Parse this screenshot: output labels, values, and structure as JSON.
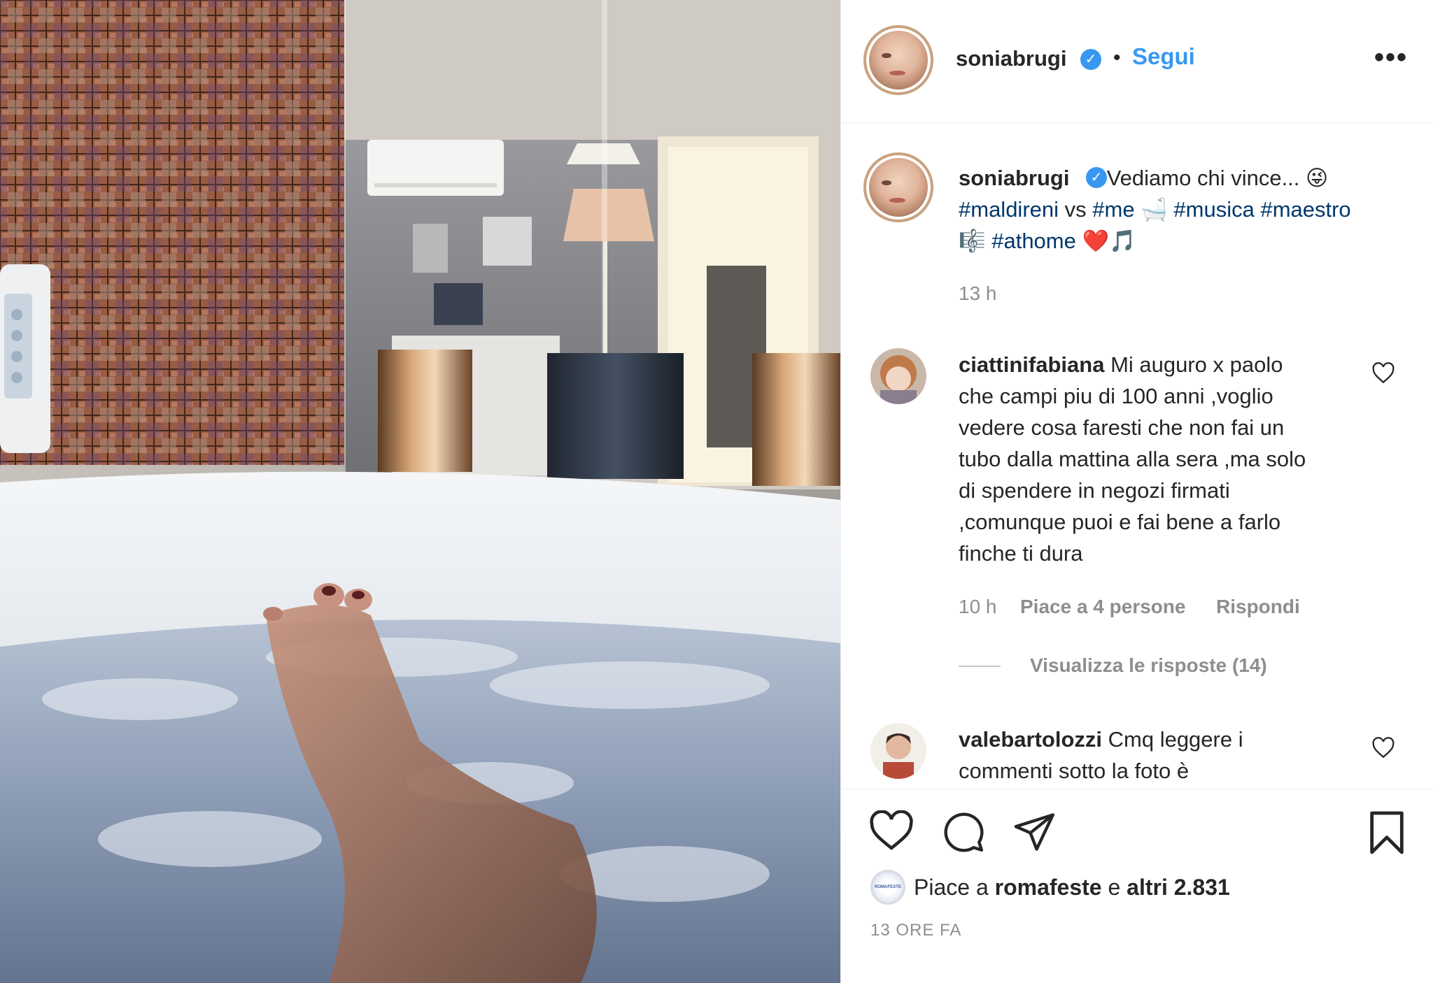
{
  "post": {
    "author": "soniabrugi",
    "follow_label": "Segui",
    "separator": "•",
    "more_label": "•••",
    "verified_mark": "✓"
  },
  "caption": {
    "username": "soniabrugi",
    "line1": "Vediamo chi vince... 😜",
    "line2_parts": [
      "#maldireni",
      " vs ",
      "#me",
      " 🛁 ",
      "#musica",
      " ",
      "#maestro"
    ],
    "line3_parts": [
      "🎼 ",
      "#athome",
      " ❤️🎵"
    ],
    "time": "13 h"
  },
  "comments": [
    {
      "username": "ciattinifabiana",
      "lines": [
        "Mi auguro x paolo",
        "che campi piu di 100 anni ,voglio",
        "vedere cosa faresti che non fai un",
        "tubo dalla mattina alla sera ,ma solo",
        "di spendere in negozi firmati",
        ",comunque puoi e fai bene a farlo",
        "finche ti dura"
      ],
      "time": "10 h",
      "likes": "Piace a 4 persone",
      "reply": "Rispondi",
      "view_replies": "Visualizza le risposte (14)"
    },
    {
      "username": "valebartolozzi",
      "lines": [
        "Cmq leggere i",
        "commenti sotto la foto è"
      ]
    }
  ],
  "likes": {
    "prefix": "Piace a ",
    "user": "romafeste",
    "middle": " e ",
    "others": "altri 2.831",
    "avatar_text": "ROMAFESTE"
  },
  "timestamp": "13 ORE FA",
  "icons": {
    "like": "heart-icon",
    "comment": "comment-icon",
    "share": "share-icon",
    "save": "bookmark-icon"
  },
  "colors": {
    "link": "#3897f0",
    "hashtag": "#00376b",
    "muted": "#8e8e8e",
    "text": "#262626"
  }
}
